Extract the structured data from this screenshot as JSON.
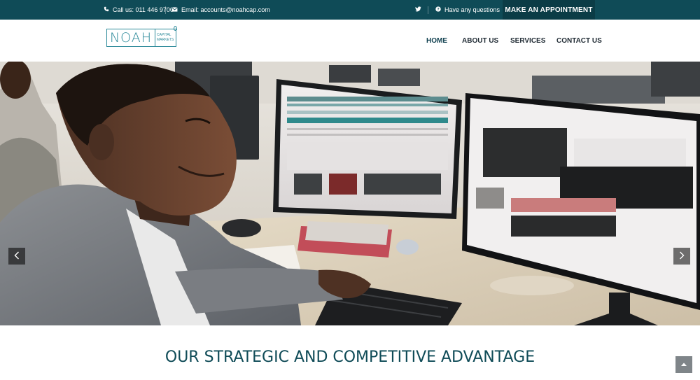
{
  "topbar": {
    "phone_text": "Call us: 011 446 9700",
    "email_text": "Email: accounts@noahcap.com",
    "questions_text": "Have any questions",
    "appointment_label": "MAKE AN APPOINTMENT"
  },
  "logo": {
    "word": "NOAH",
    "sub_line1": "CAPITAL",
    "sub_line2": "MARKETS"
  },
  "nav": {
    "items": [
      "HOME",
      "ABOUT US",
      "SERVICES",
      "CONTACT US"
    ],
    "active": "HOME"
  },
  "hero": {
    "prev_icon": "chevron-left-icon",
    "next_icon": "chevron-right-icon"
  },
  "section": {
    "title": "OUR STRATEGIC AND COMPETITIVE ADVANTAGE"
  },
  "colors": {
    "topbar": "#0f4b57",
    "appointment": "#0b3c46",
    "title": "#0f4b57"
  }
}
